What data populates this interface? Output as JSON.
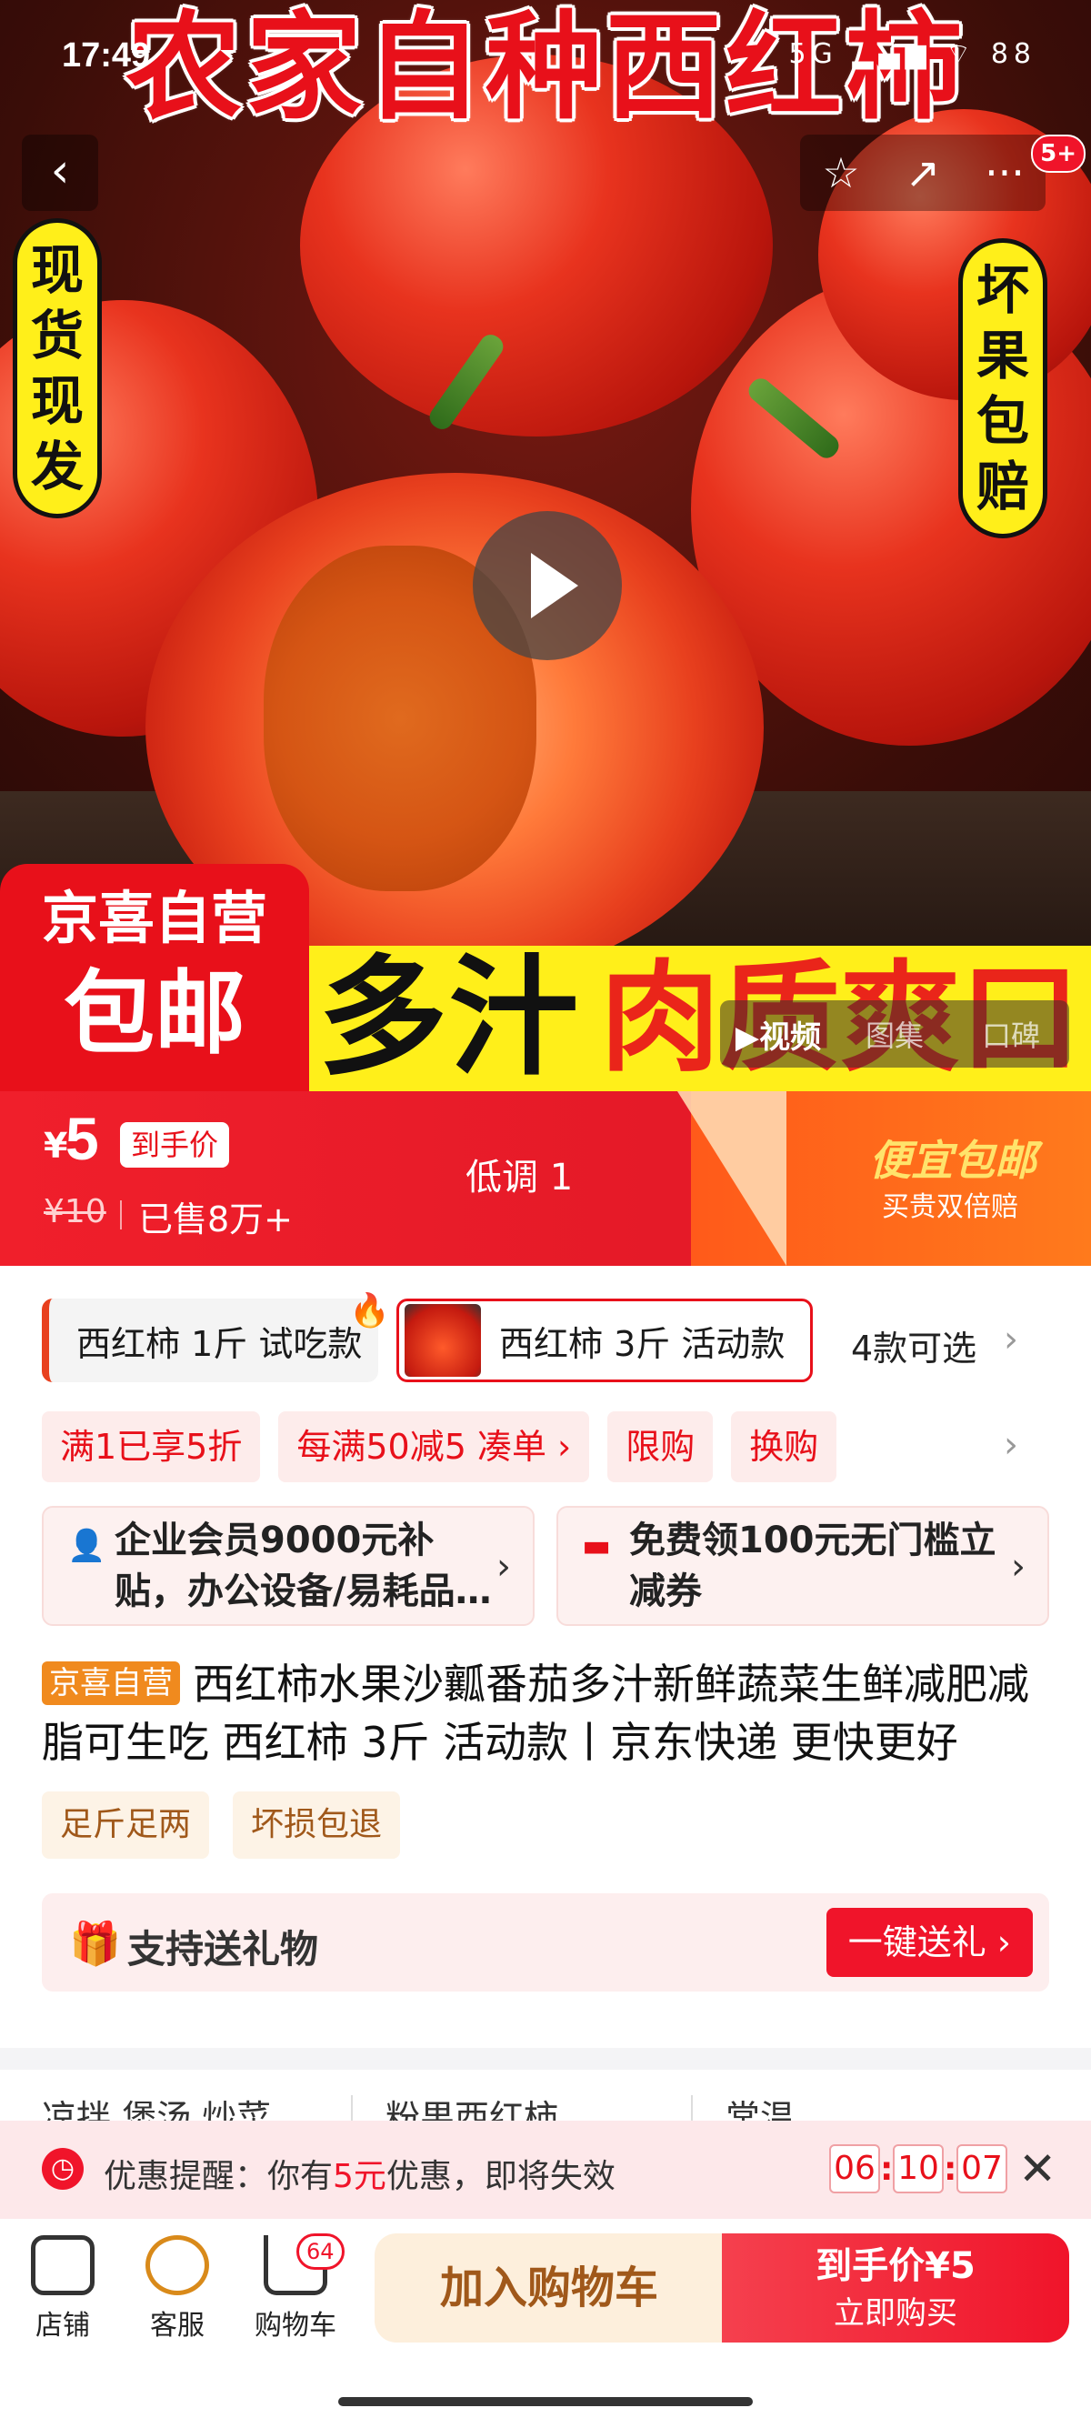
{
  "status_bar": {
    "time": "17:49",
    "icons": "5G ▂▄▆ ⌔ 88"
  },
  "hero": {
    "title": "农家自种西红柿",
    "left_badge": [
      "现",
      "货",
      "现",
      "发"
    ],
    "right_badge": [
      "坏",
      "果",
      "包",
      "赔"
    ],
    "banner_black": "多汁",
    "banner_red": "肉质爽口",
    "store_badge_line1": "京喜自营",
    "store_badge_line2": "包邮",
    "notif_count": "5+",
    "media_tabs": [
      {
        "label": "▶视频",
        "active": true
      },
      {
        "label": "图集",
        "active": false
      },
      {
        "label": "口碑",
        "active": false
      }
    ]
  },
  "nav": {
    "back": "‹",
    "favorite": "☆",
    "share": "↗",
    "more": "···"
  },
  "price_bar": {
    "currency": "¥",
    "price": "5",
    "price_tag": "到手价",
    "original_price": "¥10",
    "sold": "已售8万+",
    "lowkey": "低调 1",
    "promo_title": "便宜包邮",
    "promo_sub": "买贵双倍赔"
  },
  "variants": {
    "items": [
      {
        "label": "西红柿 1斤 试吃款"
      },
      {
        "label": "西红柿 3斤 活动款"
      }
    ],
    "count": "4款可选",
    "fire_icon": "🔥"
  },
  "promos": [
    "满1已享5折",
    "每满50减5 凑单 ›",
    "限购",
    "换购"
  ],
  "coupons": [
    {
      "text": "企业会员9000元补贴，办公设备/易耗品…",
      "icon": "👤"
    },
    {
      "text": "免费领100元无门槛立减券",
      "icon": "▬"
    }
  ],
  "product": {
    "store_tag": "京喜自营",
    "title": "西红柿水果沙瓤番茄多汁新鲜蔬菜生鲜减肥减脂可生吃 西红柿 3斤 活动款丨京东快递 更快更好",
    "features": [
      "足斤足两",
      "坏损包退"
    ]
  },
  "gift": {
    "icon": "🎁",
    "label": "支持送礼物",
    "button": "一键送礼 ›"
  },
  "spec_row": [
    "凉拌 煲汤 炒菜",
    "粉果西红柿",
    "常温"
  ],
  "alert": {
    "prefix": "优惠提醒：你有",
    "amount": "5元",
    "suffix": "优惠，即将失效",
    "timer": [
      "06",
      "10",
      "07"
    ],
    "close": "✕"
  },
  "bottom": {
    "store_label": "店铺",
    "service_label": "客服",
    "cart_label": "购物车",
    "cart_count": "64",
    "add_cart": "加入购物车",
    "buy_price": "到手价¥5",
    "buy_now": "立即购买"
  }
}
